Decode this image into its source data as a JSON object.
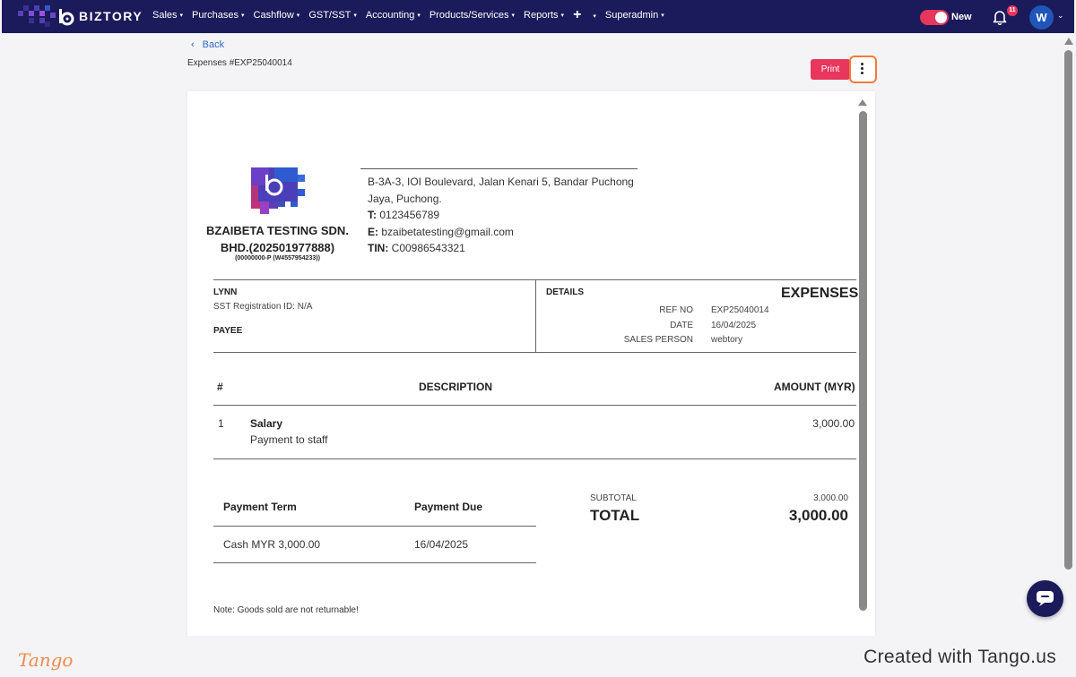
{
  "app": {
    "brand": "BIZTORY",
    "nav": [
      {
        "label": "Sales",
        "caret": "▾"
      },
      {
        "label": "Purchases",
        "caret": "▾"
      },
      {
        "label": "Cashflow",
        "caret": "▾"
      },
      {
        "label": "GST/SST",
        "caret": "▾"
      },
      {
        "label": "Accounting",
        "caret": "▾"
      },
      {
        "label": "Products/Services",
        "caret": "▾"
      },
      {
        "label": "Reports",
        "caret": "▾"
      }
    ],
    "nav_plus": "+",
    "nav_plus_caret": "▾",
    "superadmin": "Superadmin",
    "superadmin_caret": "▾",
    "toggle_label": "New",
    "notification_count": "11",
    "avatar_initial": "W",
    "avatar_caret": "⌄",
    "accent": "#e8365d",
    "nav_bg": "#1b1a5a"
  },
  "header": {
    "back_label": "Back",
    "doc_id": "Expenses #EXP25040014",
    "print_label": "Print"
  },
  "company": {
    "name": "BZAIBETA TESTING SDN. BHD.(202501977888)",
    "reg": "(00000000-P (W4557954233))",
    "address": "B-3A-3, IOI Boulevard, Jalan Kenari 5, Bandar Puchong Jaya, Puchong.",
    "phone_label": "T:",
    "phone": "0123456789",
    "email_label": "E:",
    "email": "bzaibetatesting@gmail.com",
    "tin_label": "TIN:",
    "tin": "C00986543321"
  },
  "payee": {
    "name": "LYNN",
    "sst": "SST Registration ID: N/A",
    "label": "PAYEE"
  },
  "details": {
    "label": "DETAILS",
    "doc_title": "EXPENSES",
    "ref_no_label": "REF NO",
    "ref_no": "EXP25040014",
    "date_label": "DATE",
    "date": "16/04/2025",
    "sales_person_label": "SALES PERSON",
    "sales_person": "webtory"
  },
  "items": {
    "col_num": "#",
    "col_desc": "DESCRIPTION",
    "col_amount": "AMOUNT (MYR)",
    "rows": [
      {
        "num": "1",
        "title": "Salary",
        "desc": "Payment to staff",
        "amount": "3,000.00"
      }
    ]
  },
  "payment": {
    "term_label": "Payment Term",
    "due_label": "Payment Due",
    "term": "Cash MYR 3,000.00",
    "due": "16/04/2025"
  },
  "totals": {
    "subtotal_label": "SUBTOTAL",
    "subtotal": "3,000.00",
    "total_label": "TOTAL",
    "total": "3,000.00"
  },
  "note": "Note: Goods sold are not returnable!",
  "footer": {
    "logo_text": "Tango",
    "credit": "Created with Tango.us"
  }
}
